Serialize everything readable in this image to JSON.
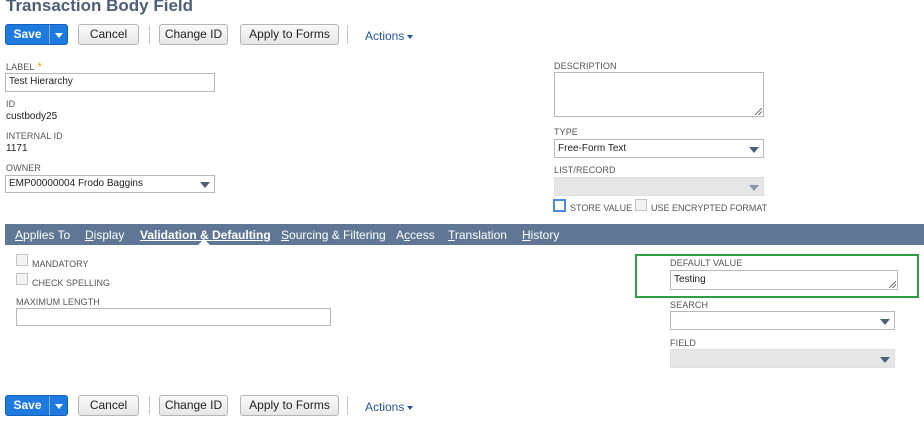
{
  "page": {
    "title": "Transaction Body Field"
  },
  "toolbar": {
    "save_label": "Save",
    "cancel_label": "Cancel",
    "change_id_label": "Change ID",
    "apply_to_forms_label": "Apply to Forms",
    "actions_label": "Actions"
  },
  "fields": {
    "label": {
      "label": "LABEL",
      "required_mark": "*",
      "value": "Test Hierarchy"
    },
    "id": {
      "label": "ID",
      "value": "custbody25"
    },
    "internal_id": {
      "label": "INTERNAL ID",
      "value": "1171"
    },
    "owner": {
      "label": "OWNER",
      "value": "EMP00000004 Frodo Baggins"
    },
    "description": {
      "label": "DESCRIPTION",
      "value": ""
    },
    "type": {
      "label": "TYPE",
      "value": "Free-Form Text"
    },
    "list_record": {
      "label": "LIST/RECORD",
      "value": ""
    },
    "store_value": {
      "label": "STORE VALUE",
      "checked": false
    },
    "use_encrypted_format": {
      "label": "USE ENCRYPTED FORMAT",
      "checked": false
    }
  },
  "tabs": [
    {
      "label": "Applies To",
      "ul": "A",
      "rest": "pplies To"
    },
    {
      "label": "Display",
      "ul": "D",
      "rest": "isplay"
    },
    {
      "label": "Validation & Defaulting",
      "ul": "V",
      "rest": "alidation & Defaulting",
      "active": true
    },
    {
      "label": "Sourcing & Filtering",
      "ul": "S",
      "rest": "ourcing & Filtering"
    },
    {
      "label": "Access",
      "pre": "A",
      "ul": "c",
      "rest": "cess"
    },
    {
      "label": "Translation",
      "ul": "T",
      "rest": "ranslation"
    },
    {
      "label": "History",
      "ul": "H",
      "rest": "istory"
    }
  ],
  "validation": {
    "mandatory": {
      "label": "MANDATORY",
      "checked": false
    },
    "check_spelling": {
      "label": "CHECK SPELLING",
      "checked": false
    },
    "maximum_length": {
      "label": "MAXIMUM LENGTH",
      "value": ""
    },
    "default_value": {
      "label": "DEFAULT VALUE",
      "value": "Testing"
    },
    "search": {
      "label": "SEARCH",
      "value": ""
    },
    "field": {
      "label": "FIELD",
      "value": ""
    }
  },
  "colors": {
    "primary_button": "#1f7ae0",
    "tab_bar": "#5f7694",
    "title": "#4d5f79",
    "link": "#255599",
    "highlight_box": "#2ea043",
    "required": "#f0a000"
  }
}
